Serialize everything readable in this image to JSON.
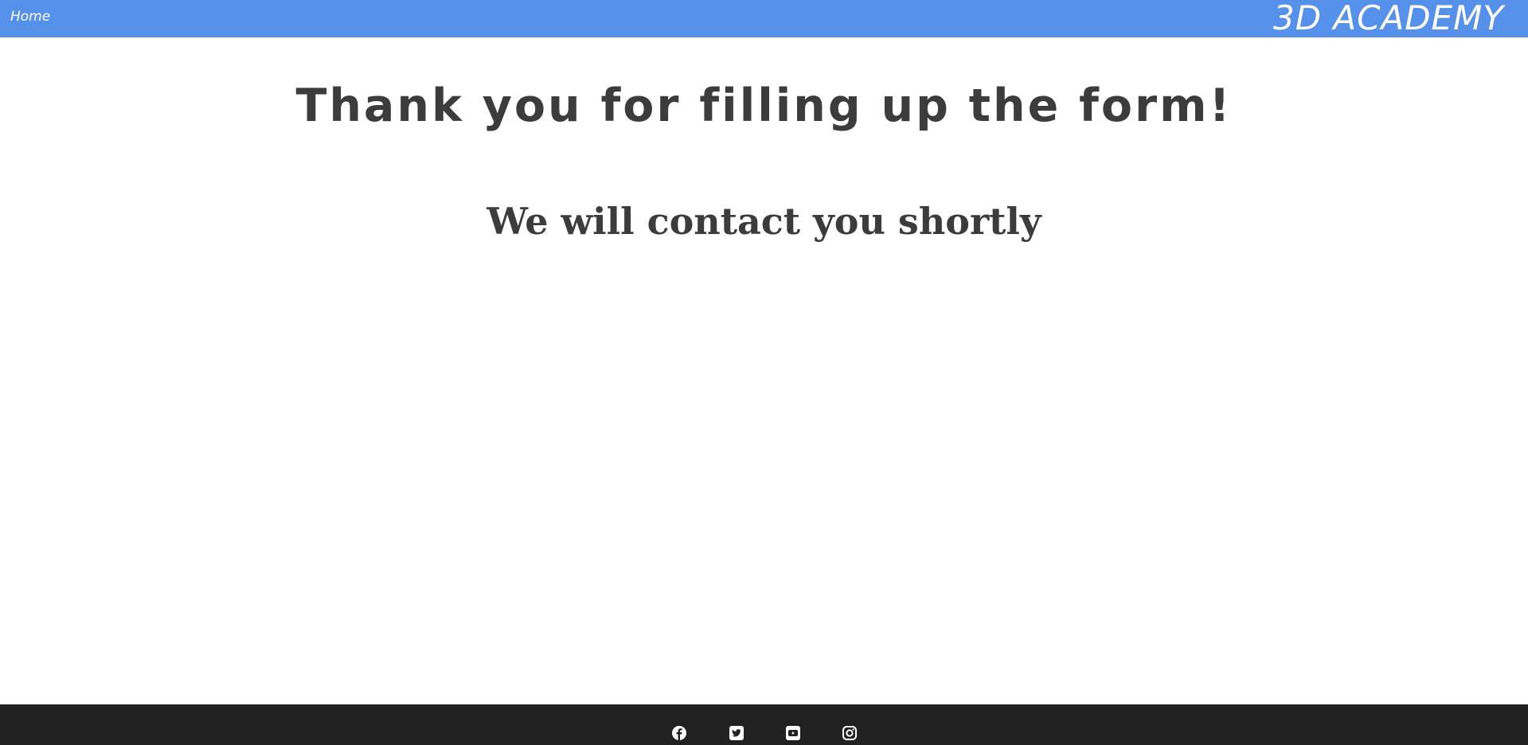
{
  "header": {
    "nav_home": "Home",
    "brand": "3D ACADEMY",
    "bar_color": "#5591ea"
  },
  "main": {
    "headline": "Thank you for filling up the form!",
    "subline": "We will contact you shortly",
    "text_color": "#3c3c3c"
  },
  "footer": {
    "bg_color": "#212121",
    "social_icons": [
      "facebook-icon",
      "twitter-icon",
      "youtube-icon",
      "instagram-icon"
    ]
  }
}
